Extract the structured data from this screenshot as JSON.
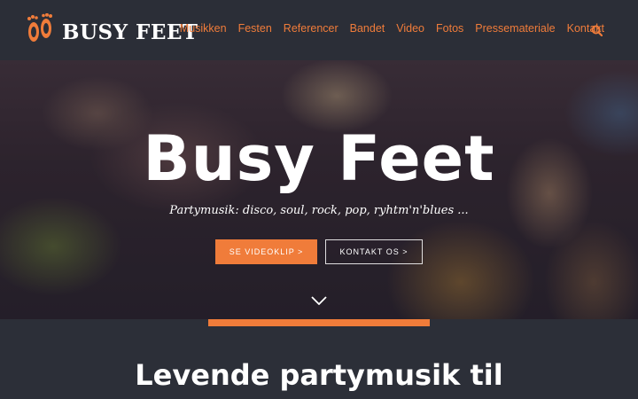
{
  "brand": {
    "name": "BUSY FEET",
    "logo_icon": "feet-icon",
    "accent_color": "#f07c3a"
  },
  "nav": {
    "items": [
      {
        "label": "Musikken"
      },
      {
        "label": "Festen"
      },
      {
        "label": "Referencer"
      },
      {
        "label": "Bandet"
      },
      {
        "label": "Video"
      },
      {
        "label": "Fotos"
      },
      {
        "label": "Pressemateriale"
      },
      {
        "label": "Kontakt"
      }
    ],
    "search_icon": "search-icon"
  },
  "hero": {
    "title": "Busy Feet",
    "subtitle": "Partymusik: disco, soul, rock, pop, ryhtm'n'blues ...",
    "primary_button": "SE VIDEOKLIP >",
    "secondary_button": "KONTAKT OS >",
    "scroll_icon": "chevron-down-icon"
  },
  "section": {
    "title": "Levende partymusik til"
  }
}
